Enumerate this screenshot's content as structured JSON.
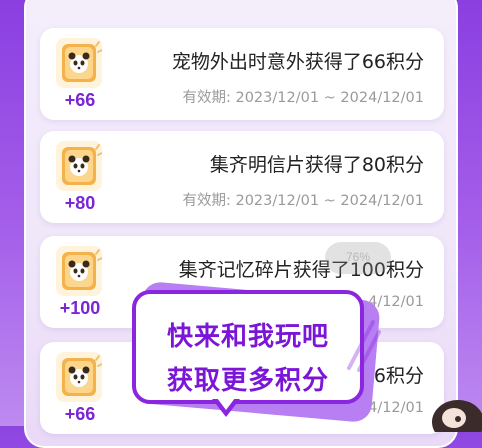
{
  "cards": [
    {
      "points": "+66",
      "title": "宠物外出时意外获得了66积分",
      "validity": "有效期: 2023/12/01 ~ 2024/12/01"
    },
    {
      "points": "+80",
      "title": "集齐明信片获得了80积分",
      "validity": "有效期: 2023/12/01 ~ 2024/12/01"
    },
    {
      "points": "+100",
      "title": "集齐记忆碎片获得了100积分",
      "validity": "4/12/01"
    },
    {
      "points": "+66",
      "title": "6积分",
      "validity": "4/12/01"
    }
  ],
  "progress_pill": "76%",
  "promo": {
    "line1": "快来和我玩吧",
    "line2": "获取更多积分"
  },
  "colors": {
    "accent_purple": "#7a26d4",
    "promo_border": "#8a25e0",
    "ticket_orange": "#f6b24a"
  },
  "icons": {
    "ticket": "panda-ticket-icon",
    "mascot": "mascot-character"
  }
}
